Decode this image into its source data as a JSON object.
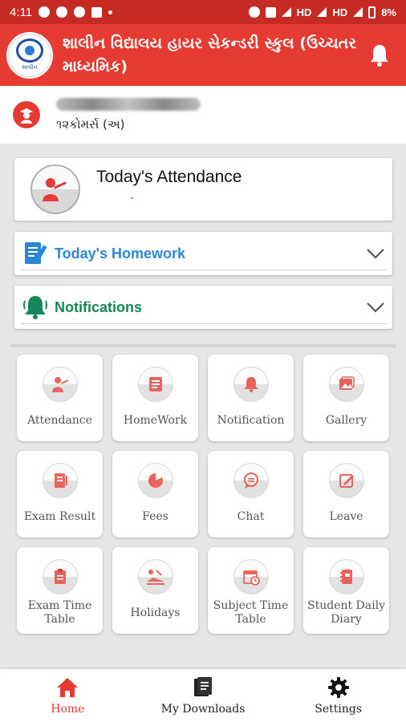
{
  "status_bar": {
    "time": "4:11",
    "network_1": "HD",
    "network_2": "HD",
    "battery": "8%"
  },
  "app_bar": {
    "title": "શાલીન વિદ્યાલય હાયર સેકન્ડરી સ્કુલ (ઉચ્ચતર માધ્યમિક)",
    "logo_text": "શાલીન",
    "bell_icon": "bell-icon"
  },
  "profile": {
    "class_name": "૧૨કોમર્સ (અ)"
  },
  "attendance": {
    "title": "Today's Attendance",
    "value": "-"
  },
  "homework": {
    "label": "Today's Homework",
    "color": "#2a87d8"
  },
  "notifications": {
    "label": "Notifications",
    "color": "#16875a"
  },
  "tiles": [
    {
      "label": "Attendance",
      "icon": "attendance-icon"
    },
    {
      "label": "HomeWork",
      "icon": "homework-icon"
    },
    {
      "label": "Notification",
      "icon": "notification-icon"
    },
    {
      "label": "Gallery",
      "icon": "gallery-icon"
    },
    {
      "label": "Exam Result",
      "icon": "exam-result-icon"
    },
    {
      "label": "Fees",
      "icon": "fees-icon"
    },
    {
      "label": "Chat",
      "icon": "chat-icon"
    },
    {
      "label": "Leave",
      "icon": "leave-icon"
    },
    {
      "label": "Exam Time Table",
      "icon": "exam-timetable-icon"
    },
    {
      "label": "Holidays",
      "icon": "holidays-icon"
    },
    {
      "label": "Subject Time Table",
      "icon": "subject-timetable-icon"
    },
    {
      "label": "Student Daily Diary",
      "icon": "diary-icon"
    }
  ],
  "bottom_nav": [
    {
      "label": "Home",
      "icon": "home-icon",
      "active": true
    },
    {
      "label": "My Downloads",
      "icon": "downloads-icon",
      "active": false
    },
    {
      "label": "Settings",
      "icon": "settings-icon",
      "active": false
    }
  ],
  "colors": {
    "primary": "#e53b33",
    "status_bar": "#c62b23",
    "background": "#e6e6e6"
  }
}
